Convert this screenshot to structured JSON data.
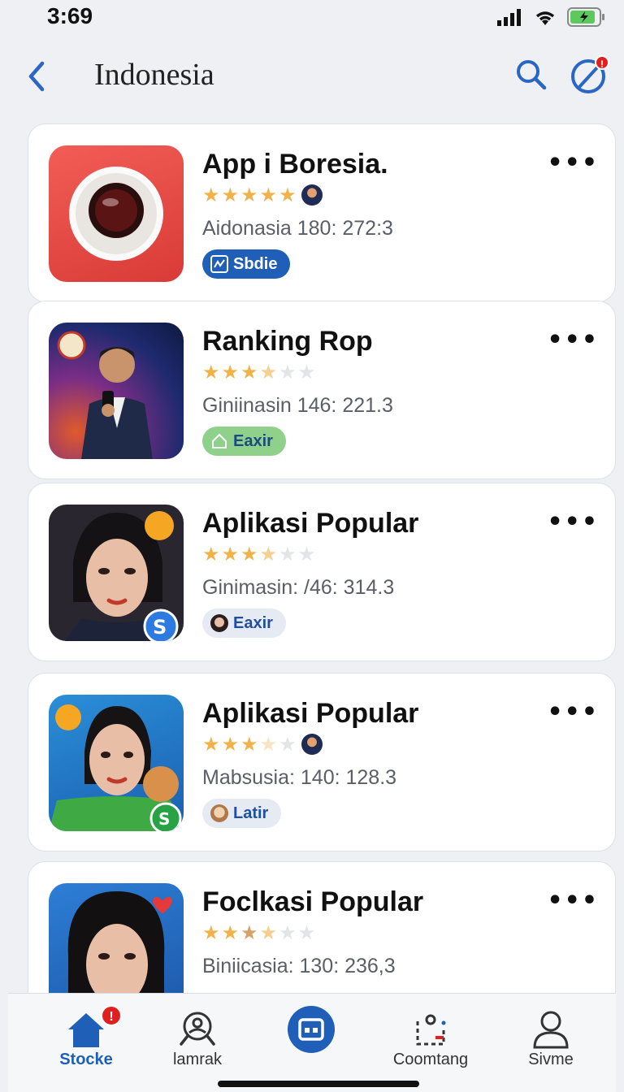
{
  "status_bar": {
    "time": "3:69"
  },
  "nav": {
    "title": "Indonesia",
    "notification_count": "!"
  },
  "apps": [
    {
      "name": "App i Boresia.",
      "rating": 5,
      "meta": "Aidonasia 180: 272:3",
      "badge": "Sbdie",
      "badge_style": "blue"
    },
    {
      "name": "Ranking Rop",
      "rating": 3.5,
      "meta": "Giniinasin 146: 221.3",
      "badge": "Eaxir",
      "badge_style": "green"
    },
    {
      "name": "Aplikasi Popular",
      "rating": 3.5,
      "meta": "Ginimasin: /46: 314.3",
      "badge": "Eaxir",
      "badge_style": "light"
    },
    {
      "name": "Aplikasi Popular",
      "rating": 3,
      "meta": "Mabsusia: 140: 128.3",
      "badge": "Latir",
      "badge_style": "light"
    },
    {
      "name": "Foclkasi Popular",
      "rating": 3.5,
      "meta": "Biniicasia: 130: 236,3",
      "badge": "",
      "badge_style": "light"
    }
  ],
  "tabs": [
    {
      "label": "Stocke",
      "icon": "home-icon",
      "active": true,
      "badge": "!"
    },
    {
      "label": "lamrak",
      "icon": "profile-search-icon",
      "active": false
    },
    {
      "label": "",
      "icon": "center-action-icon",
      "active": false
    },
    {
      "label": "Coomtang",
      "icon": "activity-icon",
      "active": false
    },
    {
      "label": "Sivme",
      "icon": "user-icon",
      "active": false
    }
  ],
  "colors": {
    "accent": "#1f5fb8",
    "star": "#f2b24a",
    "alert": "#e02020"
  }
}
